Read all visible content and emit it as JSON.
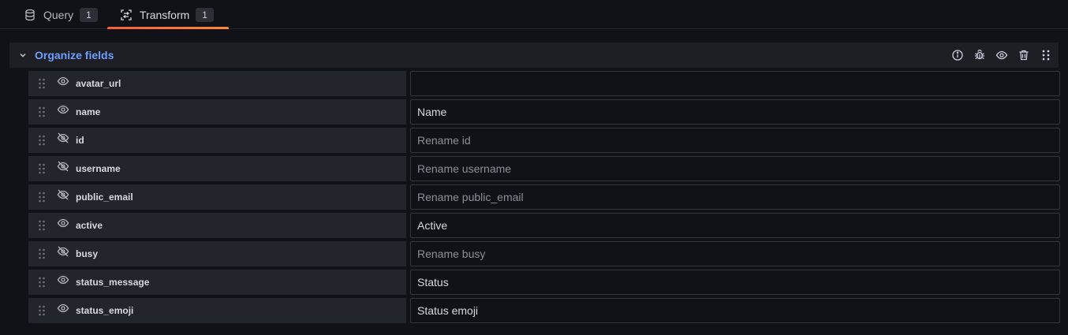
{
  "tabs": [
    {
      "label": "Query",
      "badge": "1",
      "icon": "database-icon"
    },
    {
      "label": "Transform",
      "badge": "1",
      "icon": "transform-icon",
      "active": true
    }
  ],
  "section": {
    "title": "Organize fields",
    "actions": [
      "info-icon",
      "debug-icon",
      "eye-icon",
      "trash-icon",
      "drag-icon"
    ]
  },
  "fields": [
    {
      "name": "avatar_url",
      "visible": true,
      "value": "",
      "placeholder": ""
    },
    {
      "name": "name",
      "visible": true,
      "value": "Name",
      "placeholder": ""
    },
    {
      "name": "id",
      "visible": false,
      "value": "",
      "placeholder": "Rename id"
    },
    {
      "name": "username",
      "visible": false,
      "value": "",
      "placeholder": "Rename username"
    },
    {
      "name": "public_email",
      "visible": false,
      "value": "",
      "placeholder": "Rename public_email"
    },
    {
      "name": "active",
      "visible": true,
      "value": "Active",
      "placeholder": ""
    },
    {
      "name": "busy",
      "visible": false,
      "value": "",
      "placeholder": "Rename busy"
    },
    {
      "name": "status_message",
      "visible": true,
      "value": "Status",
      "placeholder": ""
    },
    {
      "name": "status_emoji",
      "visible": true,
      "value": "Status emoji",
      "placeholder": ""
    }
  ],
  "colors": {
    "accent": "#6e9fff",
    "tab_underline_start": "#f55f3e",
    "tab_underline_end": "#ff8833",
    "row_bg": "#22252b",
    "background": "#111217"
  }
}
